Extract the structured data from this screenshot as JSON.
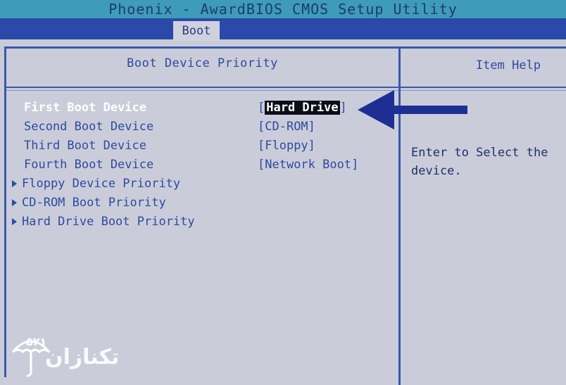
{
  "window": {
    "title": "Phoenix - AwardBIOS CMOS Setup Utility"
  },
  "menu": {
    "active_tab": "Boot"
  },
  "left_panel": {
    "header": "Boot Device Priority",
    "items": [
      {
        "label": "First Boot Device",
        "value": "Hard Drive",
        "selected": true
      },
      {
        "label": "Second Boot Device",
        "value": "CD-ROM"
      },
      {
        "label": "Third Boot Device",
        "value": "Floppy"
      },
      {
        "label": "Fourth Boot Device",
        "value": "Network Boot"
      }
    ],
    "submenus": [
      {
        "label": "Floppy Device Priority"
      },
      {
        "label": "CD-ROM Boot Priority"
      },
      {
        "label": "Hard Drive Boot Priority"
      }
    ]
  },
  "right_panel": {
    "header": "Item Help",
    "text": "Enter to Select the device."
  },
  "watermark": {
    "text": "تکنازان",
    "number": "۵۲۱"
  },
  "colors": {
    "accent": "#2a49a8",
    "arrow": "#1e2f94",
    "selection": "#0b0e18",
    "panel": "#cacdd9"
  },
  "icons": [
    "submenu-arrow-icon",
    "pointer-arrow-icon",
    "umbrella-logo-icon"
  ]
}
